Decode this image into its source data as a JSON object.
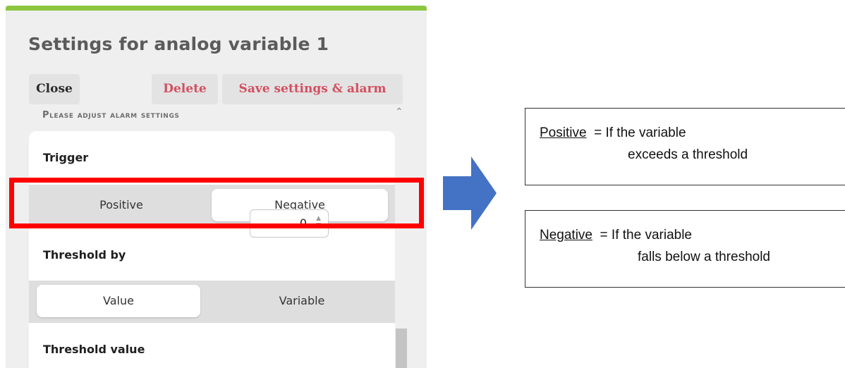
{
  "dialog": {
    "title": "Settings for analog variable 1",
    "buttons": {
      "close": "Close",
      "delete": "Delete",
      "save": "Save settings & alarm"
    },
    "section_label": "Please adjust alarm settings",
    "trigger": {
      "label": "Trigger",
      "options": [
        "Positive",
        "Negative"
      ],
      "selected": "Negative"
    },
    "threshold_by": {
      "label": "Threshold by",
      "options": [
        "Value",
        "Variable"
      ],
      "selected": "Value"
    },
    "threshold_value": {
      "label": "Threshold value",
      "value": "0"
    }
  },
  "annotations": {
    "positive": {
      "term": "Positive",
      "line1": "  = If the variable",
      "line2": "exceeds a threshold"
    },
    "negative": {
      "term": "Negative",
      "line1": "  = If the variable",
      "line2": "falls below a threshold"
    }
  },
  "colors": {
    "accent_green": "#8cc63f",
    "danger_text": "#d24f60",
    "highlight": "#ff0000",
    "arrow": "#4472c4"
  },
  "icons": {
    "scroll_up": "chevron-up-icon",
    "stepper": "up-down-spinner-icon",
    "arrow": "right-arrow-icon"
  }
}
